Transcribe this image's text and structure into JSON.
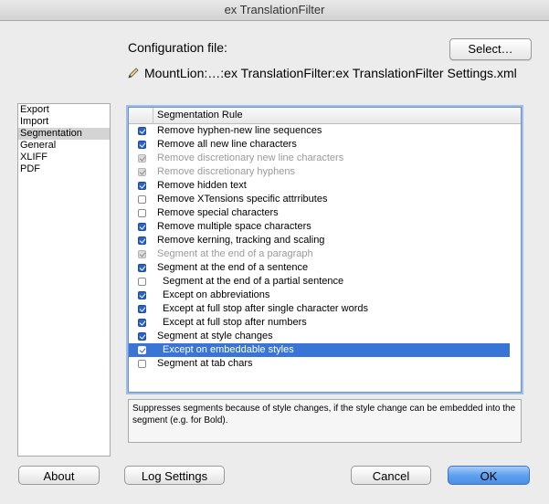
{
  "window": {
    "title": "ex TranslationFilter"
  },
  "config": {
    "label": "Configuration file:",
    "select_button": "Select…",
    "path": "MountLion:…:ex TranslationFilter:ex TranslationFilter Settings.xml"
  },
  "sidebar": {
    "items": [
      {
        "label": "Export"
      },
      {
        "label": "Import"
      },
      {
        "label": "Segmentation"
      },
      {
        "label": "General"
      },
      {
        "label": "XLIFF"
      },
      {
        "label": "PDF"
      }
    ]
  },
  "table": {
    "header": "Segmentation Rule",
    "rows": [
      {
        "label": "Remove hyphen-new line sequences"
      },
      {
        "label": "Remove all new line characters"
      },
      {
        "label": "Remove discretionary new line characters"
      },
      {
        "label": "Remove discretionary hyphens"
      },
      {
        "label": "Remove hidden text"
      },
      {
        "label": "Remove XTensions specific attrributes"
      },
      {
        "label": "Remove special characters"
      },
      {
        "label": "Remove multiple space characters"
      },
      {
        "label": "Remove kerning, tracking and scaling"
      },
      {
        "label": "Segment at the end of a paragraph"
      },
      {
        "label": "Segment at the end of a sentence"
      },
      {
        "label": "Segment at the end of a partial sentence"
      },
      {
        "label": "Except on abbreviations"
      },
      {
        "label": "Except at full stop after single character words"
      },
      {
        "label": "Except at full stop after numbers"
      },
      {
        "label": "Segment at style changes"
      },
      {
        "label": "Except on embeddable styles"
      },
      {
        "label": "Segment at tab chars"
      }
    ]
  },
  "description": "Suppresses segments because of style changes, if the style change can be embedded into the segment (e.g. for Bold).",
  "buttons": {
    "about": "About",
    "log_settings": "Log Settings",
    "cancel": "Cancel",
    "ok": "OK"
  }
}
